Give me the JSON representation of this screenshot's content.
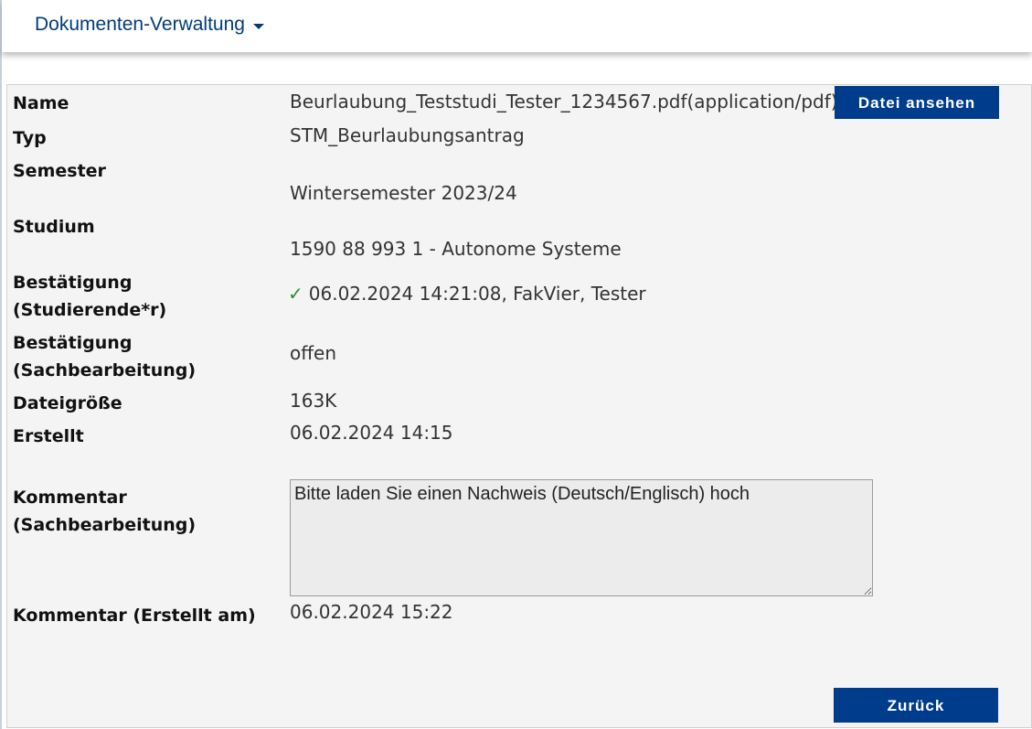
{
  "header": {
    "menu_label": "Dokumenten-Verwaltung"
  },
  "details": {
    "name_label": "Name",
    "name_value": "Beurlaubung_Teststudi_Tester_1234567.pdf(application/pdf)",
    "view_button": "Datei ansehen",
    "type_label": "Typ",
    "type_value": "STM_Beurlaubungsantrag",
    "semester_label": "Semester",
    "semester_value": "Wintersemester 2023/24",
    "study_label": "Studium",
    "study_value": "1590 88 993 1 - Autonome Systeme",
    "confirm_student_label_1": "Bestätigung",
    "confirm_student_label_2": "(Studierende*r)",
    "confirm_student_value": "06.02.2024 14:21:08, FakVier, Tester",
    "confirm_admin_label_1": "Bestätigung",
    "confirm_admin_label_2": "(Sachbearbeitung)",
    "confirm_admin_value": "offen",
    "size_label": "Dateigröße",
    "size_value": "163K",
    "created_label": "Erstellt",
    "created_value": "06.02.2024 14:15",
    "comment_label_1": "Kommentar",
    "comment_label_2": "(Sachbearbeitung)",
    "comment_value": "Bitte laden Sie einen Nachweis (Deutsch/Englisch) hoch",
    "comment_created_label": "Kommentar (Erstellt am)",
    "comment_created_value": "06.02.2024 15:22"
  },
  "actions": {
    "back_button": "Zurück"
  },
  "colors": {
    "primary": "#003c8c",
    "check": "#2e8b2e",
    "panel_bg": "#f4f4f4"
  },
  "icons": {
    "check": "checkmark-icon",
    "dropdown": "caret-down-icon"
  }
}
